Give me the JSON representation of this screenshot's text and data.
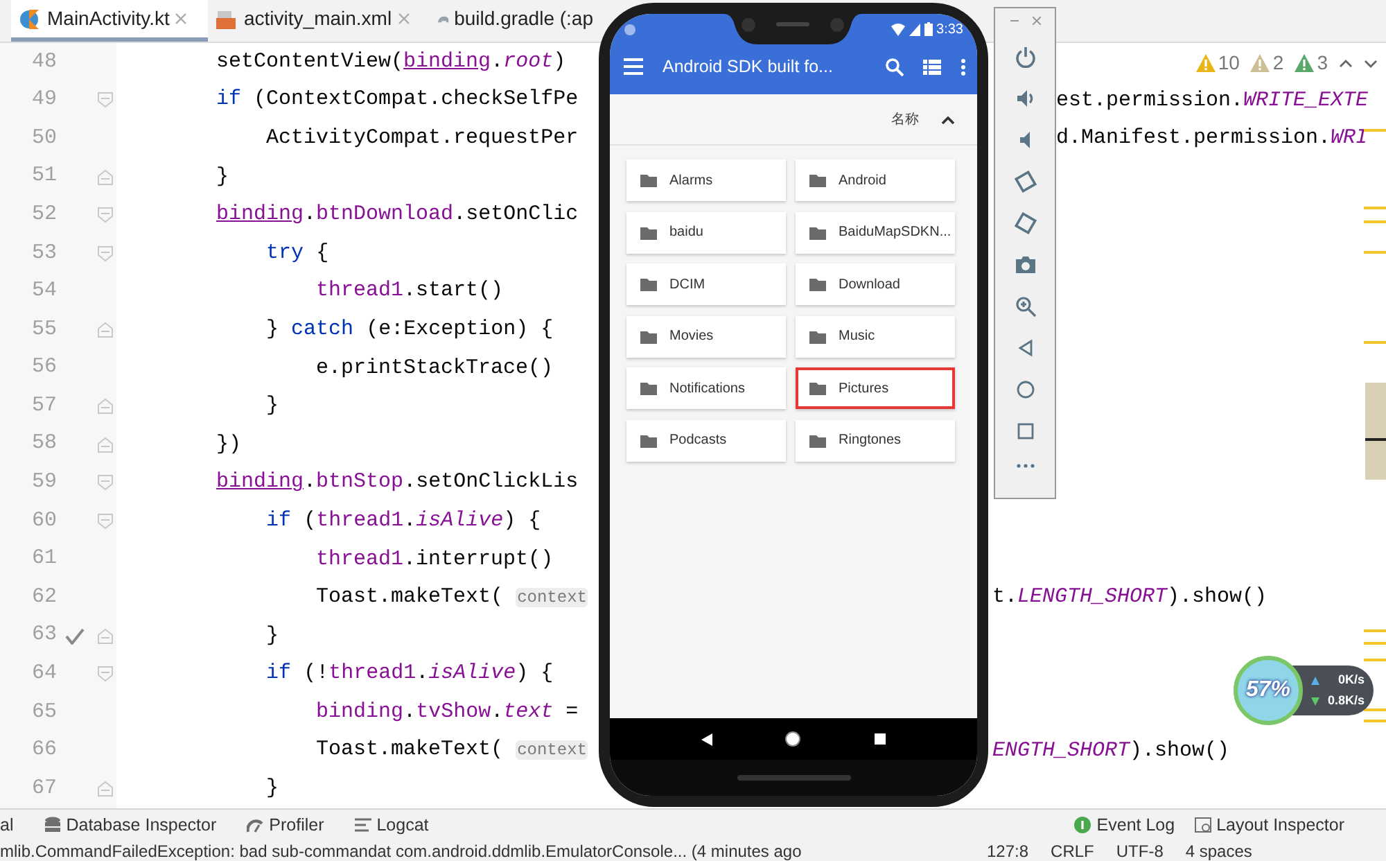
{
  "editor_tabs": [
    {
      "label": "MainActivity.kt",
      "selected": true,
      "closable": true,
      "kind": "kotlin"
    },
    {
      "label": "activity_main.xml",
      "selected": false,
      "closable": true,
      "kind": "xml"
    },
    {
      "label": "build.gradle (:ap",
      "selected": false,
      "closable": false,
      "kind": "gradle"
    }
  ],
  "inspections": [
    {
      "count": "10",
      "color": "#e8b51a"
    },
    {
      "count": "2",
      "color": "#cdbf95"
    },
    {
      "count": "3",
      "color": "#59a869"
    }
  ],
  "code_lines": [
    {
      "number": "48",
      "kind": "plain",
      "checked": false,
      "left": [
        {
          "kind": "code",
          "text": "        setContentView("
        },
        {
          "kind": "binding",
          "text": "binding"
        },
        {
          "kind": "code",
          "text": "."
        },
        {
          "kind": "static",
          "text": "root"
        },
        {
          "kind": "code",
          "text": ")"
        }
      ]
    },
    {
      "number": "49",
      "kind": "fold_start",
      "checked": false,
      "left": [
        {
          "kind": "keyword",
          "text": "        if"
        },
        {
          "kind": "code",
          "text": " (ContextCompat.checkSelfPe"
        }
      ],
      "right": [
        {
          "kind": "code",
          "text": "est.permission."
        },
        {
          "kind": "static",
          "text": "WRITE_EXTE"
        }
      ]
    },
    {
      "number": "50",
      "kind": "plain",
      "checked": false,
      "left": [
        {
          "kind": "code",
          "text": "            ActivityCompat.requestPer"
        }
      ],
      "right": [
        {
          "kind": "code",
          "text": "d.Manifest.permission."
        },
        {
          "kind": "static",
          "text": "WRI"
        }
      ]
    },
    {
      "number": "51",
      "kind": "fold_end",
      "checked": false,
      "left": [
        {
          "kind": "code",
          "text": "        }"
        }
      ]
    },
    {
      "number": "52",
      "kind": "fold_start",
      "checked": false,
      "left": [
        {
          "kind": "binding",
          "text": "        binding"
        },
        {
          "kind": "code",
          "text": "."
        },
        {
          "kind": "field",
          "text": "btnDownload"
        },
        {
          "kind": "code",
          "text": ".setOnClic"
        }
      ]
    },
    {
      "number": "53",
      "kind": "fold_start",
      "checked": false,
      "left": [
        {
          "kind": "keyword",
          "text": "            try"
        },
        {
          "kind": "code",
          "text": " {"
        }
      ]
    },
    {
      "number": "54",
      "kind": "plain",
      "checked": false,
      "left": [
        {
          "kind": "field",
          "text": "                thread1"
        },
        {
          "kind": "code",
          "text": ".start()"
        }
      ]
    },
    {
      "number": "55",
      "kind": "fold_end",
      "checked": false,
      "left": [
        {
          "kind": "code",
          "text": "            } "
        },
        {
          "kind": "keyword",
          "text": "catch"
        },
        {
          "kind": "code",
          "text": " (e:Exception) {"
        }
      ]
    },
    {
      "number": "56",
      "kind": "plain",
      "checked": false,
      "left": [
        {
          "kind": "code",
          "text": "                e.printStackTrace()"
        }
      ]
    },
    {
      "number": "57",
      "kind": "fold_end",
      "checked": false,
      "left": [
        {
          "kind": "code",
          "text": "            }"
        }
      ]
    },
    {
      "number": "58",
      "kind": "fold_end",
      "checked": false,
      "left": [
        {
          "kind": "code",
          "text": "        })"
        }
      ]
    },
    {
      "number": "59",
      "kind": "fold_start",
      "checked": false,
      "left": [
        {
          "kind": "binding",
          "text": "        binding"
        },
        {
          "kind": "code",
          "text": "."
        },
        {
          "kind": "field",
          "text": "btnStop"
        },
        {
          "kind": "code",
          "text": ".setOnClickLis"
        }
      ]
    },
    {
      "number": "60",
      "kind": "fold_start",
      "checked": false,
      "left": [
        {
          "kind": "keyword",
          "text": "            if"
        },
        {
          "kind": "code",
          "text": " ("
        },
        {
          "kind": "field",
          "text": "thread1"
        },
        {
          "kind": "code",
          "text": "."
        },
        {
          "kind": "static",
          "text": "isAlive"
        },
        {
          "kind": "code",
          "text": ") {"
        }
      ]
    },
    {
      "number": "61",
      "kind": "plain",
      "checked": false,
      "left": [
        {
          "kind": "field",
          "text": "                thread1"
        },
        {
          "kind": "code",
          "text": ".interrupt()"
        }
      ]
    },
    {
      "number": "62",
      "kind": "plain",
      "checked": false,
      "left": [
        {
          "kind": "code",
          "text": "                Toast.makeText( "
        },
        {
          "kind": "hint",
          "text": "context"
        }
      ],
      "right": [
        {
          "kind": "code",
          "text": "t."
        },
        {
          "kind": "static",
          "text": "LENGTH_SHORT"
        },
        {
          "kind": "code",
          "text": ").show()"
        }
      ]
    },
    {
      "number": "63",
      "kind": "fold_end",
      "checked": true,
      "left": [
        {
          "kind": "code",
          "text": "            }"
        }
      ]
    },
    {
      "number": "64",
      "kind": "fold_start",
      "checked": false,
      "left": [
        {
          "kind": "keyword",
          "text": "            if"
        },
        {
          "kind": "code",
          "text": " (!"
        },
        {
          "kind": "field",
          "text": "thread1"
        },
        {
          "kind": "code",
          "text": "."
        },
        {
          "kind": "static",
          "text": "isAlive"
        },
        {
          "kind": "code",
          "text": ") {"
        }
      ]
    },
    {
      "number": "65",
      "kind": "plain",
      "checked": false,
      "left": [
        {
          "kind": "field",
          "text": "                binding"
        },
        {
          "kind": "code",
          "text": "."
        },
        {
          "kind": "field",
          "text": "tvShow"
        },
        {
          "kind": "code",
          "text": "."
        },
        {
          "kind": "static",
          "text": "text"
        },
        {
          "kind": "code",
          "text": " ="
        }
      ]
    },
    {
      "number": "66",
      "kind": "plain",
      "checked": false,
      "left": [
        {
          "kind": "code",
          "text": "                Toast.makeText( "
        },
        {
          "kind": "hint",
          "text": "context"
        }
      ],
      "right": [
        {
          "kind": "static",
          "text": "ENGTH_SHORT"
        },
        {
          "kind": "code",
          "text": ").show()"
        }
      ]
    },
    {
      "number": "67",
      "kind": "fold_end",
      "checked": false,
      "left": [
        {
          "kind": "code",
          "text": "            }"
        }
      ]
    }
  ],
  "emulator": {
    "time": "3:33",
    "app_title": "Android SDK built fo...",
    "sort_label": "名称",
    "folders": [
      {
        "name": "Alarms",
        "highlighted": false
      },
      {
        "name": "Android",
        "highlighted": false
      },
      {
        "name": "baidu",
        "highlighted": false
      },
      {
        "name": "BaiduMapSDKN...",
        "highlighted": false
      },
      {
        "name": "DCIM",
        "highlighted": false
      },
      {
        "name": "Download",
        "highlighted": false
      },
      {
        "name": "Movies",
        "highlighted": false
      },
      {
        "name": "Music",
        "highlighted": false
      },
      {
        "name": "Notifications",
        "highlighted": false
      },
      {
        "name": "Pictures",
        "highlighted": true
      },
      {
        "name": "Podcasts",
        "highlighted": false
      },
      {
        "name": "Ringtones",
        "highlighted": false
      }
    ]
  },
  "net_monitor": {
    "percent": "57%",
    "upload": "0K/s",
    "download": "0.8K/s"
  },
  "tool_windows_left": [
    {
      "label": "al",
      "kind": "none"
    },
    {
      "label": "Database Inspector",
      "kind": "database"
    },
    {
      "label": "Profiler",
      "kind": "profiler"
    },
    {
      "label": "Logcat",
      "kind": "logcat"
    }
  ],
  "tool_windows_right": [
    {
      "label": "Event Log",
      "kind": "event"
    },
    {
      "label": "Layout Inspector",
      "kind": "layout"
    }
  ],
  "status_bar": {
    "message": "mlib.CommandFailedException: bad sub-commandat com.android.ddmlib.EmulatorConsole... (4 minutes ago",
    "items": [
      "127:8",
      "CRLF",
      "UTF-8",
      "4 spaces"
    ]
  }
}
